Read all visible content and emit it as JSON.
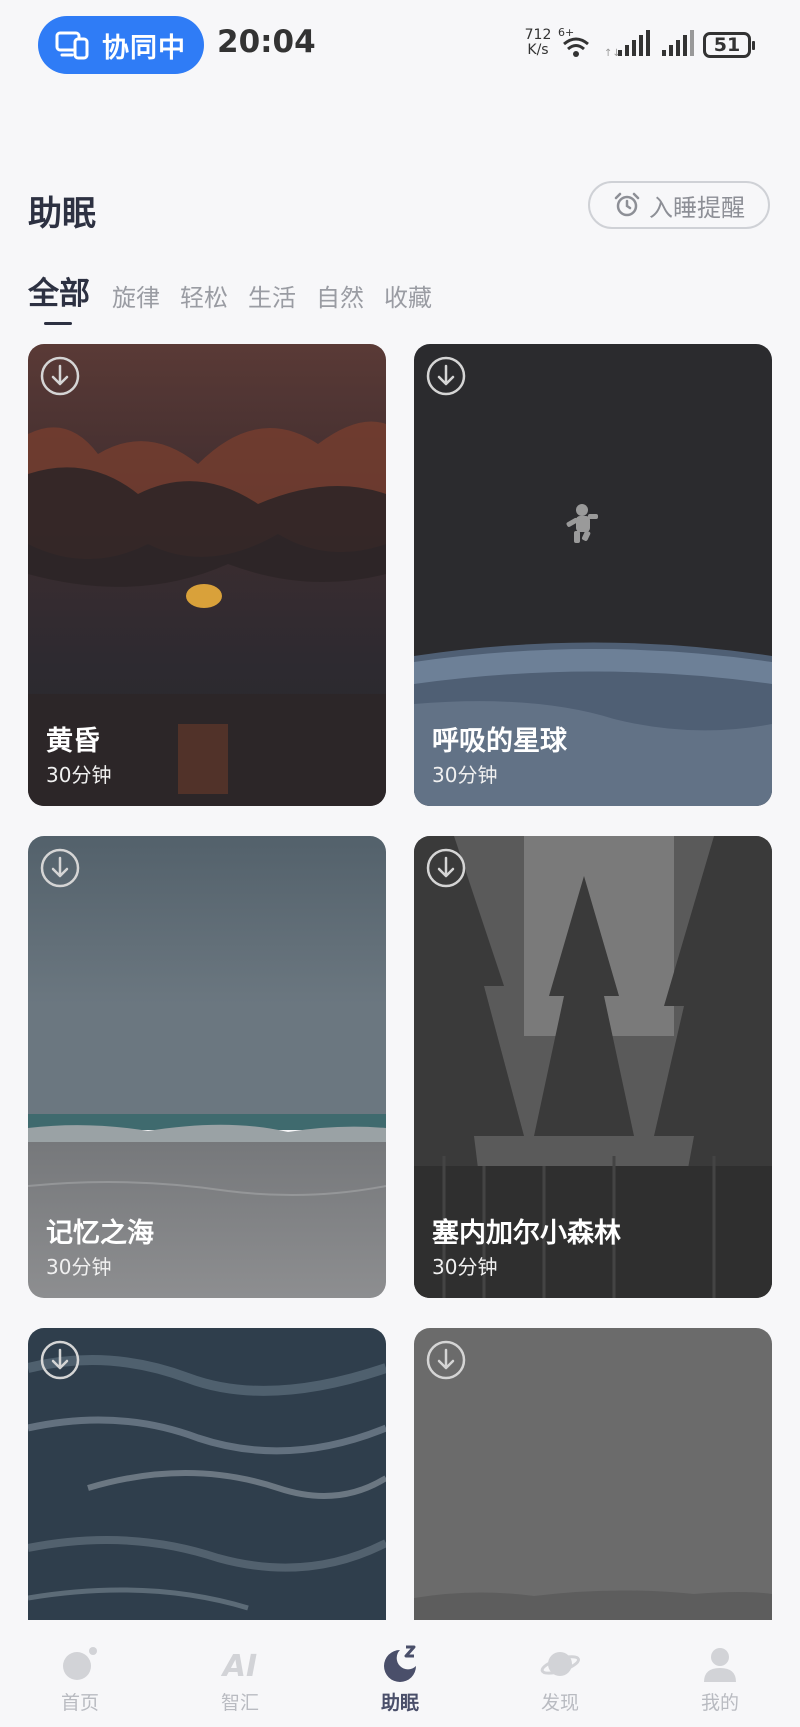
{
  "status_bar": {
    "sync_label": "协同中",
    "time": "20:04",
    "net_speed_value": "712",
    "net_speed_unit": "K/s",
    "wifi_tag": "6+",
    "battery": "51"
  },
  "header": {
    "title": "助眠",
    "sleep_reminder_label": "入睡提醒"
  },
  "tabs": [
    {
      "label": "全部",
      "active": true
    },
    {
      "label": "旋律",
      "active": false
    },
    {
      "label": "轻松",
      "active": false
    },
    {
      "label": "生活",
      "active": false
    },
    {
      "label": "自然",
      "active": false
    },
    {
      "label": "收藏",
      "active": false
    }
  ],
  "cards": [
    {
      "name": "黄昏",
      "duration": "30分钟",
      "icon": "download-icon"
    },
    {
      "name": "呼吸的星球",
      "duration": "30分钟",
      "icon": "download-icon"
    },
    {
      "name": "记忆之海",
      "duration": "30分钟",
      "icon": "download-icon"
    },
    {
      "name": "塞内加尔小森林",
      "duration": "30分钟",
      "icon": "download-icon"
    },
    {
      "name": "",
      "duration": "",
      "icon": "download-icon"
    },
    {
      "name": "",
      "duration": "",
      "icon": "download-icon"
    }
  ],
  "bottom_nav": [
    {
      "label": "首页",
      "icon": "home-icon",
      "active": false
    },
    {
      "label": "智汇",
      "icon": "ai-icon",
      "active": false
    },
    {
      "label": "助眠",
      "icon": "sleep-icon",
      "active": true
    },
    {
      "label": "发现",
      "icon": "planet-icon",
      "active": false
    },
    {
      "label": "我的",
      "icon": "profile-icon",
      "active": false
    }
  ],
  "colors": {
    "accent": "#2f7cf6",
    "text_primary": "#2d3142",
    "text_muted": "#9a9ca3",
    "background": "#f7f7f9"
  }
}
